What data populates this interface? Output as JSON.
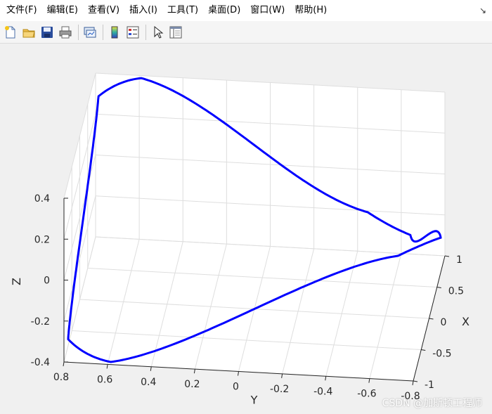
{
  "menu": {
    "items": [
      "文件(F)",
      "编辑(E)",
      "查看(V)",
      "插入(I)",
      "工具(T)",
      "桌面(D)",
      "窗口(W)",
      "帮助(H)"
    ],
    "arrow": "↘"
  },
  "toolbar": {
    "icons": [
      "new-figure-icon",
      "open-file-icon",
      "save-icon",
      "print-icon",
      "link-plot-icon",
      "colorbar-icon",
      "legend-icon",
      "pointer-icon",
      "property-inspector-icon"
    ]
  },
  "chart_data": {
    "type": "line",
    "projection": "3d",
    "series": [
      {
        "color": "#0000ff",
        "parametric": "x = sin(2t), y = cos(t), z = 0.5*sin(t)"
      }
    ],
    "x_axis": {
      "label": "X",
      "range": [
        -1,
        1
      ],
      "ticks": [
        "1",
        "0.5",
        "0",
        "-0.5",
        "-1"
      ]
    },
    "y_axis": {
      "label": "Y",
      "range": [
        -0.8,
        0.8
      ],
      "ticks": [
        "0.8",
        "0.6",
        "0.4",
        "0.2",
        "0",
        "-0.2",
        "-0.4",
        "-0.6",
        "-0.8"
      ]
    },
    "z_axis": {
      "label": "Z",
      "range": [
        -0.4,
        0.4
      ],
      "ticks": [
        "0.4",
        "0.2",
        "0",
        "-0.2",
        "-0.4"
      ]
    },
    "grid": true,
    "line_color": "#0000ff",
    "grid_color": "#dedede",
    "axis_color": "#262626"
  },
  "watermark": "CSDN @加斯顿工程师"
}
